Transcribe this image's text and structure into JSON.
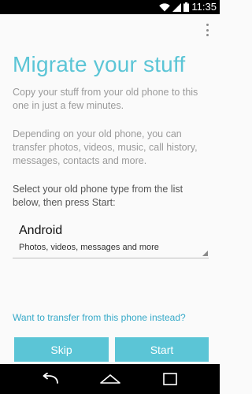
{
  "status_bar": {
    "time": "11:35"
  },
  "icons": {
    "wifi": "wifi-icon",
    "signal": "signal-icon",
    "battery": "battery-icon",
    "overflow": "overflow-menu-icon",
    "back": "back-icon",
    "home": "home-icon",
    "recents": "recents-icon"
  },
  "colors": {
    "accent": "#5bc5d6",
    "link": "#36a9c8"
  },
  "main": {
    "title": "Migrate your stuff",
    "intro": "Copy your stuff from your old phone to this one in just a few minutes.",
    "details": "Depending on your old phone, you can transfer photos, videos, music, call history, messages, contacts and more.",
    "instruction": "Select your old phone type from the list below, then press Start:",
    "selector": {
      "selected": "Android",
      "description": "Photos, videos, messages and more"
    },
    "transfer_link": "Want to transfer from this phone instead?"
  },
  "buttons": {
    "skip": "Skip",
    "start": "Start"
  }
}
